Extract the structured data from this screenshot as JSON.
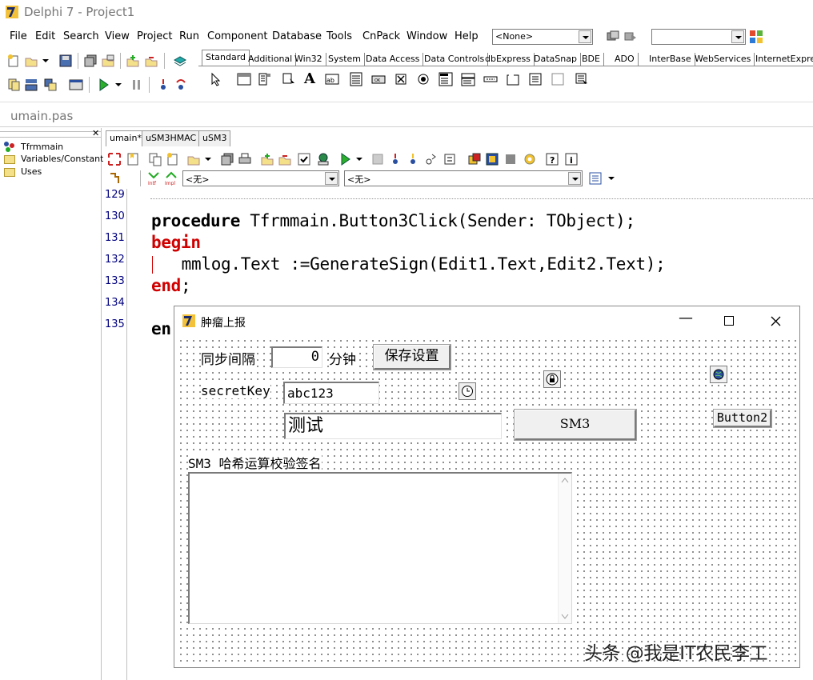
{
  "window": {
    "title": "Delphi 7 - Project1"
  },
  "menu": [
    "File",
    "Edit",
    "Search",
    "View",
    "Project",
    "Run",
    "Component",
    "Database",
    "Tools",
    "CnPack",
    "Window",
    "Help"
  ],
  "toolbar": {
    "config_combo": "<None>",
    "second_combo": ""
  },
  "palette": {
    "tabs": [
      "Standard",
      "Additional",
      "Win32",
      "System",
      "Data Access",
      "Data Controls",
      "dbExpress",
      "DataSnap",
      "BDE",
      "ADO",
      "InterBase",
      "WebServices",
      "InternetExpress"
    ],
    "active": "Standard"
  },
  "file_tab": "umain.pas",
  "tree": [
    "Tfrmmain",
    "Variables/Constants",
    "Uses"
  ],
  "editor": {
    "tabs": [
      "umain*",
      "uSM3HMAC",
      "uSM3"
    ],
    "combo_left": "<无>",
    "combo_right": "<无>",
    "lines": [
      {
        "num": "129",
        "text": ""
      },
      {
        "num": "130",
        "kw": "procedure",
        "rest": " Tfrmmain.Button3Click(Sender: TObject);"
      },
      {
        "num": "131",
        "kw": "begin",
        "rest": ""
      },
      {
        "num": "132",
        "kw": "",
        "rest": "  mmlog.Text :=GenerateSign(Edit1.Text,Edit2.Text);"
      },
      {
        "num": "133",
        "kw": "end",
        "rest": ";"
      },
      {
        "num": "134",
        "text": ""
      },
      {
        "num": "135",
        "kw": "en",
        "rest": ""
      }
    ]
  },
  "form": {
    "title": "肿瘤上报",
    "sync_label": "同步间隔",
    "sync_value": "0",
    "minutes_label": "分钟",
    "save_button": "保存设置",
    "secret_label": "secretKey",
    "secret_value": "abc123",
    "test_value": "测试",
    "sm3_button": "SM3",
    "button2": "Button2",
    "memo_label": "SM3 哈希运算校验签名"
  },
  "watermark": "头条 @我是IT农民李工",
  "colors": {
    "keyword_red": "#d00000",
    "gutter_text": "#000080"
  }
}
